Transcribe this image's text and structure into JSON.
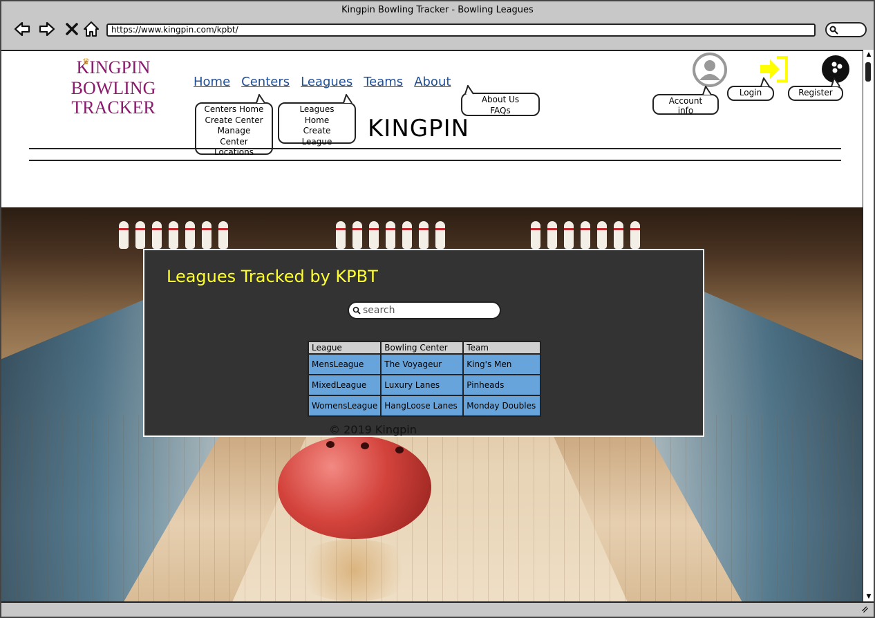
{
  "window": {
    "title": "Kingpin Bowling Tracker - Bowling Leagues"
  },
  "browser": {
    "url": "https://www.kingpin.com/kpbt/",
    "back_icon": "arrow-left-icon",
    "forward_icon": "arrow-right-icon",
    "stop_icon": "close-icon",
    "home_icon": "home-icon",
    "search_icon": "search-icon"
  },
  "logo": {
    "line1": "KINGPIN",
    "line2": "BOWLING TRACKER",
    "color": "#8b1a6e"
  },
  "nav": {
    "items": [
      "Home",
      "Centers",
      "Leagues",
      "Teams",
      "About"
    ],
    "color": "#1f4e95"
  },
  "menus": {
    "centers": [
      "Centers Home",
      "Create Center",
      "Manage",
      "Center",
      "Locations"
    ],
    "leagues": [
      "Leagues",
      "Home",
      "Create",
      "League"
    ],
    "about": [
      "About Us",
      "FAQs"
    ]
  },
  "brand": "KINGPIN",
  "account": {
    "account_label": [
      "Account",
      "info"
    ],
    "login_label": "Login",
    "register_label": "Register",
    "login_icon_color": "#ffff00"
  },
  "panel": {
    "title": "Leagues Tracked by KPBT",
    "title_color": "#ffff2e",
    "search_placeholder": "search",
    "table": {
      "headers": [
        "League",
        "Bowling Center",
        "Team"
      ],
      "rows": [
        [
          "MensLeague",
          "The Voyageur",
          "King's Men"
        ],
        [
          "MixedLeague",
          "Luxury Lanes",
          "Pinheads"
        ],
        [
          "WomensLeague",
          "HangLoose Lanes",
          "Monday Doubles"
        ]
      ],
      "cell_color": "#68a4dc"
    }
  },
  "footer": "© 2019 Kingpin"
}
